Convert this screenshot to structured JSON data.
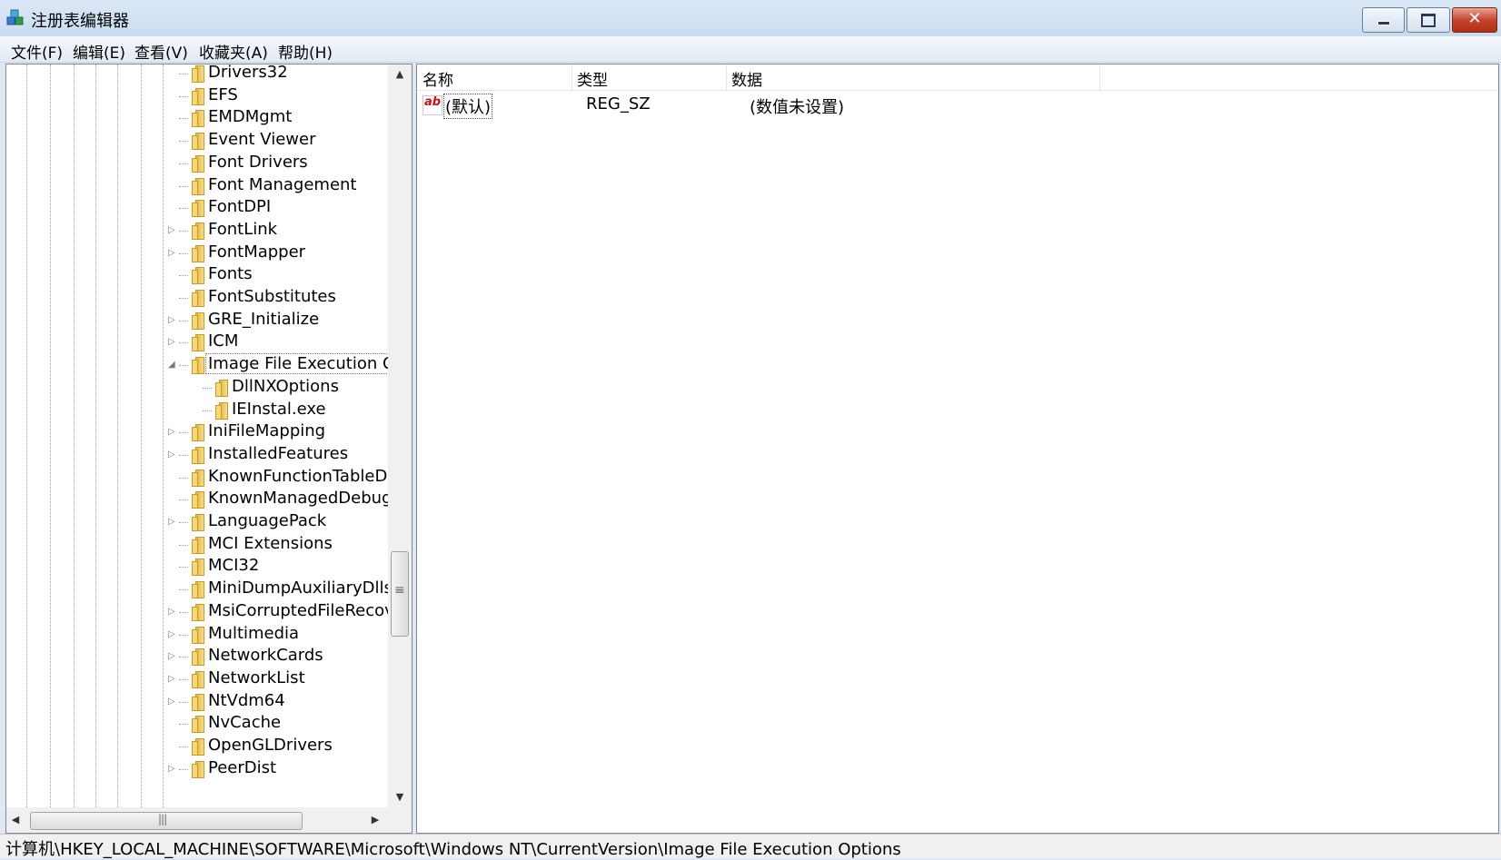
{
  "window": {
    "title": "注册表编辑器",
    "close_glyph": "✕"
  },
  "menu": [
    "文件(F)",
    "编辑(E)",
    "查看(V)",
    "收藏夹(A)",
    "帮助(H)"
  ],
  "tree": {
    "items": [
      {
        "label": "Drivers32",
        "expander": ""
      },
      {
        "label": "EFS",
        "expander": ""
      },
      {
        "label": "EMDMgmt",
        "expander": ""
      },
      {
        "label": "Event Viewer",
        "expander": ""
      },
      {
        "label": "Font Drivers",
        "expander": ""
      },
      {
        "label": "Font Management",
        "expander": ""
      },
      {
        "label": "FontDPI",
        "expander": ""
      },
      {
        "label": "FontLink",
        "expander": "▷"
      },
      {
        "label": "FontMapper",
        "expander": "▷"
      },
      {
        "label": "Fonts",
        "expander": ""
      },
      {
        "label": "FontSubstitutes",
        "expander": ""
      },
      {
        "label": "GRE_Initialize",
        "expander": "▷"
      },
      {
        "label": "ICM",
        "expander": "▷"
      },
      {
        "label": "Image File Execution O",
        "expander": "◢"
      },
      {
        "label": "DllNXOptions",
        "expander": ""
      },
      {
        "label": "IEInstal.exe",
        "expander": ""
      },
      {
        "label": "IniFileMapping",
        "expander": "▷"
      },
      {
        "label": "InstalledFeatures",
        "expander": "▷"
      },
      {
        "label": "KnownFunctionTableDl",
        "expander": ""
      },
      {
        "label": "KnownManagedDebug",
        "expander": ""
      },
      {
        "label": "LanguagePack",
        "expander": "▷"
      },
      {
        "label": "MCI Extensions",
        "expander": ""
      },
      {
        "label": "MCI32",
        "expander": ""
      },
      {
        "label": "MiniDumpAuxiliaryDlls",
        "expander": ""
      },
      {
        "label": "MsiCorruptedFileRecov",
        "expander": "▷"
      },
      {
        "label": "Multimedia",
        "expander": "▷"
      },
      {
        "label": "NetworkCards",
        "expander": "▷"
      },
      {
        "label": "NetworkList",
        "expander": "▷"
      },
      {
        "label": "NtVdm64",
        "expander": "▷"
      },
      {
        "label": "NvCache",
        "expander": ""
      },
      {
        "label": "OpenGLDrivers",
        "expander": ""
      },
      {
        "label": "PeerDist",
        "expander": "▷"
      }
    ]
  },
  "scroll": {
    "up": "▲",
    "down": "▼",
    "left": "◀",
    "right": "▶"
  },
  "values": {
    "columns": [
      "名称",
      "类型",
      "数据"
    ],
    "rows": [
      {
        "icon": "ab",
        "name": "(默认)",
        "type": "REG_SZ",
        "data": "(数值未设置)"
      }
    ]
  },
  "status": {
    "path": "计算机\\HKEY_LOCAL_MACHINE\\SOFTWARE\\Microsoft\\Windows NT\\CurrentVersion\\Image File Execution Options"
  }
}
